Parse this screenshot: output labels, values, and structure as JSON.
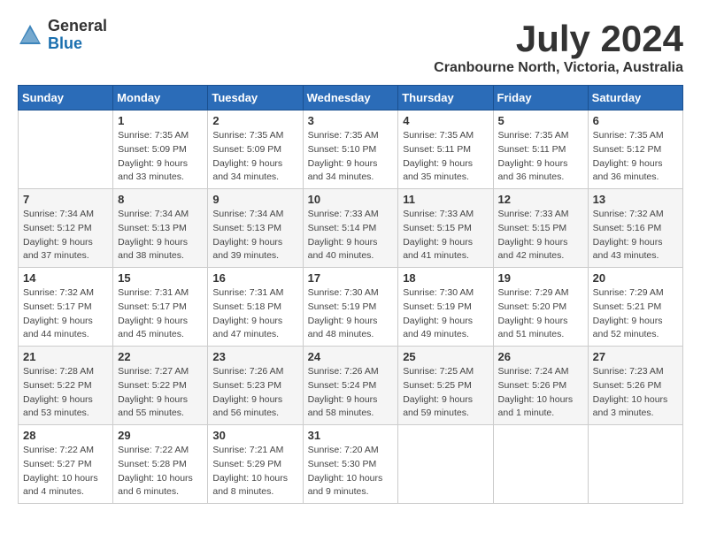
{
  "header": {
    "logo_general": "General",
    "logo_blue": "Blue",
    "title": "July 2024",
    "subtitle": "Cranbourne North, Victoria, Australia"
  },
  "weekdays": [
    "Sunday",
    "Monday",
    "Tuesday",
    "Wednesday",
    "Thursday",
    "Friday",
    "Saturday"
  ],
  "weeks": [
    [
      {
        "day": "",
        "sunrise": "",
        "sunset": "",
        "daylight": ""
      },
      {
        "day": "1",
        "sunrise": "Sunrise: 7:35 AM",
        "sunset": "Sunset: 5:09 PM",
        "daylight": "Daylight: 9 hours and 33 minutes."
      },
      {
        "day": "2",
        "sunrise": "Sunrise: 7:35 AM",
        "sunset": "Sunset: 5:09 PM",
        "daylight": "Daylight: 9 hours and 34 minutes."
      },
      {
        "day": "3",
        "sunrise": "Sunrise: 7:35 AM",
        "sunset": "Sunset: 5:10 PM",
        "daylight": "Daylight: 9 hours and 34 minutes."
      },
      {
        "day": "4",
        "sunrise": "Sunrise: 7:35 AM",
        "sunset": "Sunset: 5:11 PM",
        "daylight": "Daylight: 9 hours and 35 minutes."
      },
      {
        "day": "5",
        "sunrise": "Sunrise: 7:35 AM",
        "sunset": "Sunset: 5:11 PM",
        "daylight": "Daylight: 9 hours and 36 minutes."
      },
      {
        "day": "6",
        "sunrise": "Sunrise: 7:35 AM",
        "sunset": "Sunset: 5:12 PM",
        "daylight": "Daylight: 9 hours and 36 minutes."
      }
    ],
    [
      {
        "day": "7",
        "sunrise": "Sunrise: 7:34 AM",
        "sunset": "Sunset: 5:12 PM",
        "daylight": "Daylight: 9 hours and 37 minutes."
      },
      {
        "day": "8",
        "sunrise": "Sunrise: 7:34 AM",
        "sunset": "Sunset: 5:13 PM",
        "daylight": "Daylight: 9 hours and 38 minutes."
      },
      {
        "day": "9",
        "sunrise": "Sunrise: 7:34 AM",
        "sunset": "Sunset: 5:13 PM",
        "daylight": "Daylight: 9 hours and 39 minutes."
      },
      {
        "day": "10",
        "sunrise": "Sunrise: 7:33 AM",
        "sunset": "Sunset: 5:14 PM",
        "daylight": "Daylight: 9 hours and 40 minutes."
      },
      {
        "day": "11",
        "sunrise": "Sunrise: 7:33 AM",
        "sunset": "Sunset: 5:15 PM",
        "daylight": "Daylight: 9 hours and 41 minutes."
      },
      {
        "day": "12",
        "sunrise": "Sunrise: 7:33 AM",
        "sunset": "Sunset: 5:15 PM",
        "daylight": "Daylight: 9 hours and 42 minutes."
      },
      {
        "day": "13",
        "sunrise": "Sunrise: 7:32 AM",
        "sunset": "Sunset: 5:16 PM",
        "daylight": "Daylight: 9 hours and 43 minutes."
      }
    ],
    [
      {
        "day": "14",
        "sunrise": "Sunrise: 7:32 AM",
        "sunset": "Sunset: 5:17 PM",
        "daylight": "Daylight: 9 hours and 44 minutes."
      },
      {
        "day": "15",
        "sunrise": "Sunrise: 7:31 AM",
        "sunset": "Sunset: 5:17 PM",
        "daylight": "Daylight: 9 hours and 45 minutes."
      },
      {
        "day": "16",
        "sunrise": "Sunrise: 7:31 AM",
        "sunset": "Sunset: 5:18 PM",
        "daylight": "Daylight: 9 hours and 47 minutes."
      },
      {
        "day": "17",
        "sunrise": "Sunrise: 7:30 AM",
        "sunset": "Sunset: 5:19 PM",
        "daylight": "Daylight: 9 hours and 48 minutes."
      },
      {
        "day": "18",
        "sunrise": "Sunrise: 7:30 AM",
        "sunset": "Sunset: 5:19 PM",
        "daylight": "Daylight: 9 hours and 49 minutes."
      },
      {
        "day": "19",
        "sunrise": "Sunrise: 7:29 AM",
        "sunset": "Sunset: 5:20 PM",
        "daylight": "Daylight: 9 hours and 51 minutes."
      },
      {
        "day": "20",
        "sunrise": "Sunrise: 7:29 AM",
        "sunset": "Sunset: 5:21 PM",
        "daylight": "Daylight: 9 hours and 52 minutes."
      }
    ],
    [
      {
        "day": "21",
        "sunrise": "Sunrise: 7:28 AM",
        "sunset": "Sunset: 5:22 PM",
        "daylight": "Daylight: 9 hours and 53 minutes."
      },
      {
        "day": "22",
        "sunrise": "Sunrise: 7:27 AM",
        "sunset": "Sunset: 5:22 PM",
        "daylight": "Daylight: 9 hours and 55 minutes."
      },
      {
        "day": "23",
        "sunrise": "Sunrise: 7:26 AM",
        "sunset": "Sunset: 5:23 PM",
        "daylight": "Daylight: 9 hours and 56 minutes."
      },
      {
        "day": "24",
        "sunrise": "Sunrise: 7:26 AM",
        "sunset": "Sunset: 5:24 PM",
        "daylight": "Daylight: 9 hours and 58 minutes."
      },
      {
        "day": "25",
        "sunrise": "Sunrise: 7:25 AM",
        "sunset": "Sunset: 5:25 PM",
        "daylight": "Daylight: 9 hours and 59 minutes."
      },
      {
        "day": "26",
        "sunrise": "Sunrise: 7:24 AM",
        "sunset": "Sunset: 5:26 PM",
        "daylight": "Daylight: 10 hours and 1 minute."
      },
      {
        "day": "27",
        "sunrise": "Sunrise: 7:23 AM",
        "sunset": "Sunset: 5:26 PM",
        "daylight": "Daylight: 10 hours and 3 minutes."
      }
    ],
    [
      {
        "day": "28",
        "sunrise": "Sunrise: 7:22 AM",
        "sunset": "Sunset: 5:27 PM",
        "daylight": "Daylight: 10 hours and 4 minutes."
      },
      {
        "day": "29",
        "sunrise": "Sunrise: 7:22 AM",
        "sunset": "Sunset: 5:28 PM",
        "daylight": "Daylight: 10 hours and 6 minutes."
      },
      {
        "day": "30",
        "sunrise": "Sunrise: 7:21 AM",
        "sunset": "Sunset: 5:29 PM",
        "daylight": "Daylight: 10 hours and 8 minutes."
      },
      {
        "day": "31",
        "sunrise": "Sunrise: 7:20 AM",
        "sunset": "Sunset: 5:30 PM",
        "daylight": "Daylight: 10 hours and 9 minutes."
      },
      {
        "day": "",
        "sunrise": "",
        "sunset": "",
        "daylight": ""
      },
      {
        "day": "",
        "sunrise": "",
        "sunset": "",
        "daylight": ""
      },
      {
        "day": "",
        "sunrise": "",
        "sunset": "",
        "daylight": ""
      }
    ]
  ]
}
